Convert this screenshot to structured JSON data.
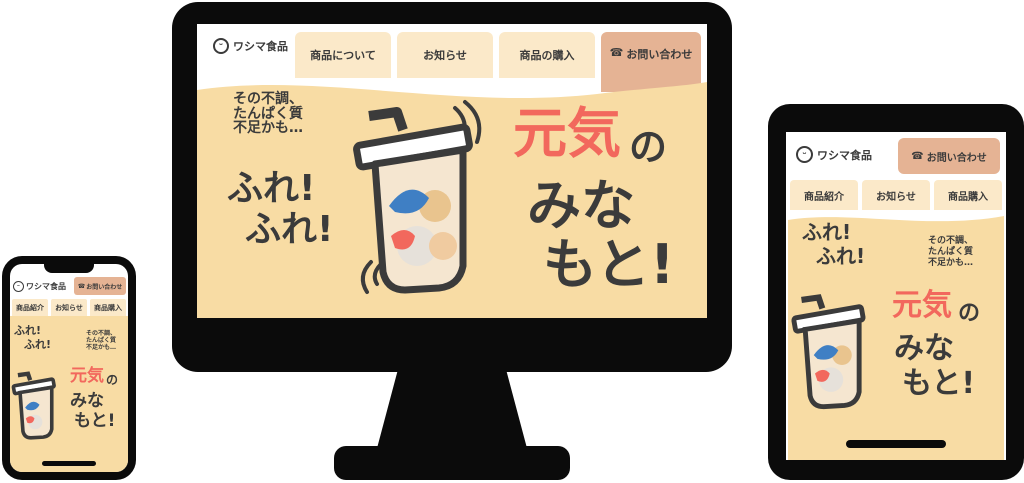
{
  "brand": {
    "name": "ワシマ食品"
  },
  "nav": {
    "products_about": "商品について",
    "news": "お知らせ",
    "purchase": "商品の購入",
    "contact": "お問い合わせ",
    "products_intro": "商品紹介",
    "purchase_short": "商品購入"
  },
  "hero": {
    "subcopy": [
      "その不調、",
      "たんぱく質",
      "不足かも…"
    ],
    "shake": [
      "ふれ!",
      "ふれ!"
    ],
    "headline_accent": "元気",
    "headline_no": "の",
    "headline_rest": [
      "みな",
      "もと!"
    ]
  },
  "icons": {
    "logo": "smiley-face-icon",
    "phone": "phone-icon",
    "cup": "shaker-cup-illustration"
  },
  "colors": {
    "accent": "#f2685d",
    "hero_bg": "#f8dca4",
    "tab_bg": "#fbe9c9",
    "contact_bg": "#e5b394",
    "frame": "#0b0b0b"
  }
}
